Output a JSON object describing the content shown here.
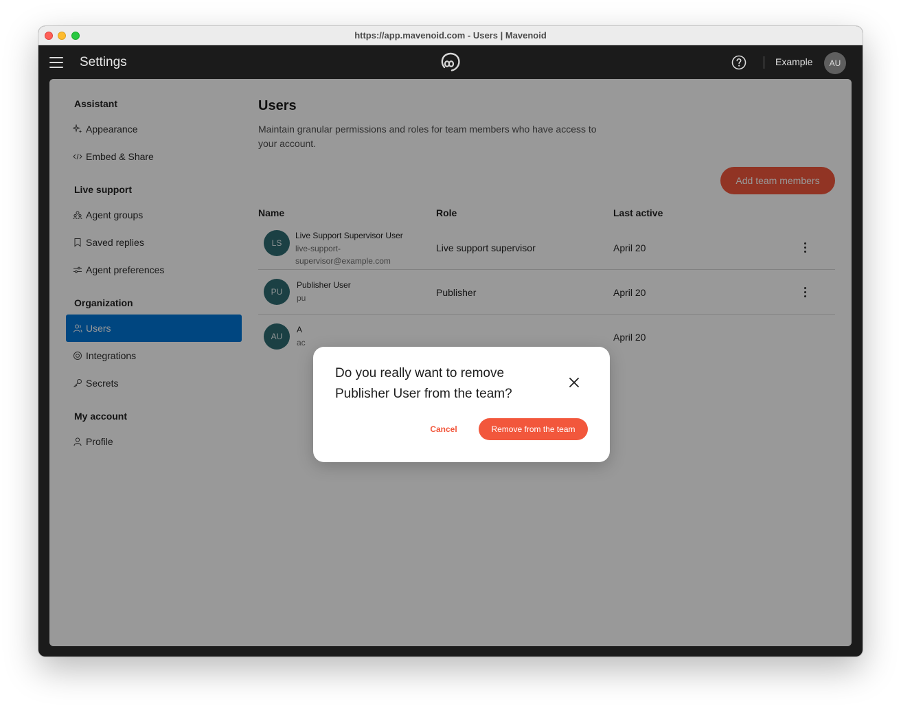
{
  "window": {
    "title": "https://app.mavenoid.com - Users | Mavenoid"
  },
  "appbar": {
    "title": "Settings",
    "org_name": "Example",
    "avatar_initials": "AU",
    "logo_icon": "mavenoid-logo-icon",
    "help_icon": "help-circle-icon"
  },
  "sidebar": {
    "sections": [
      {
        "title": "Assistant",
        "items": [
          {
            "label": "Appearance",
            "icon": "sparkle-icon"
          },
          {
            "label": "Embed & Share",
            "icon": "code-icon"
          }
        ]
      },
      {
        "title": "Live support",
        "items": [
          {
            "label": "Agent groups",
            "icon": "group-icon"
          },
          {
            "label": "Saved replies",
            "icon": "bookmark-icon"
          },
          {
            "label": "Agent preferences",
            "icon": "sliders-icon"
          }
        ]
      },
      {
        "title": "Organization",
        "items": [
          {
            "label": "Users",
            "icon": "users-icon",
            "active": true
          },
          {
            "label": "Integrations",
            "icon": "integration-icon"
          },
          {
            "label": "Secrets",
            "icon": "key-icon"
          }
        ]
      },
      {
        "title": "My account",
        "items": [
          {
            "label": "Profile",
            "icon": "person-icon"
          }
        ]
      }
    ]
  },
  "main": {
    "title": "Users",
    "description": "Maintain granular permissions and roles for team members who have access to your account.",
    "add_button": "Add team members",
    "columns": [
      "Name",
      "Role",
      "Last active"
    ],
    "rows": [
      {
        "initials": "LS",
        "name": "Live Support Supervisor User",
        "email": "live-support-supervisor@example.com",
        "email_line1": "live-support-",
        "email_line2": "supervisor@example.com",
        "role": "Live support supervisor",
        "last_active": "April 20"
      },
      {
        "initials": "PU",
        "name": "Publisher User",
        "email_visible": "pu",
        "role": "Publisher",
        "last_active": "April 20"
      },
      {
        "initials": "AU",
        "name_visible": "A",
        "email_visible": "ac",
        "role": "",
        "last_active": "April 20"
      }
    ]
  },
  "modal": {
    "message": "Do you really want to remove Publisher User from the team?",
    "cancel": "Cancel",
    "confirm": "Remove from the team"
  },
  "colors": {
    "accent": "#f2573c",
    "active_nav": "#0076d6",
    "avatar": "#2e6b72",
    "appbar": "#1b1b1b"
  }
}
